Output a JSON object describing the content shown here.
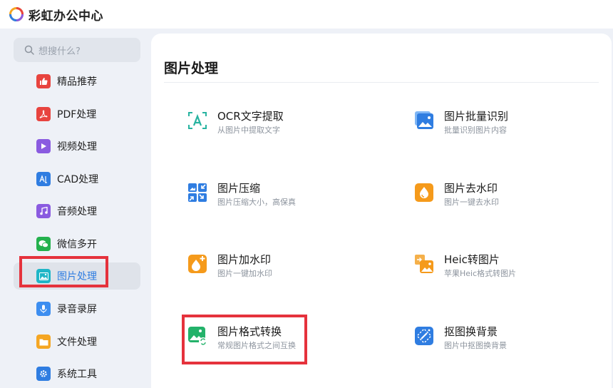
{
  "app": {
    "title": "彩虹办公中心"
  },
  "search": {
    "placeholder": "想搜什么?"
  },
  "sidebar": {
    "items": [
      {
        "label": "精品推荐",
        "icon": "thumbs-up-icon",
        "color": "#e8443f"
      },
      {
        "label": "PDF处理",
        "icon": "pdf-icon",
        "color": "#e8443f"
      },
      {
        "label": "视频处理",
        "icon": "video-play-icon",
        "color": "#8a5be0"
      },
      {
        "label": "CAD处理",
        "icon": "cad-icon",
        "color": "#2f7de1"
      },
      {
        "label": "音频处理",
        "icon": "music-note-icon",
        "color": "#8a5be0"
      },
      {
        "label": "微信多开",
        "icon": "wechat-icon",
        "color": "#23b14d"
      },
      {
        "label": "图片处理",
        "icon": "image-icon",
        "color": "#1fb6c7",
        "active": true
      },
      {
        "label": "录音录屏",
        "icon": "microphone-icon",
        "color": "#3d8ef0"
      },
      {
        "label": "文件处理",
        "icon": "folder-icon",
        "color": "#f5a623"
      },
      {
        "label": "系统工具",
        "icon": "gear-icon",
        "color": "#2f7de1"
      }
    ]
  },
  "main": {
    "section_title": "图片处理",
    "cards": [
      {
        "title": "OCR文字提取",
        "subtitle": "从图片中提取文字",
        "icon": "ocr-scan-icon"
      },
      {
        "title": "图片批量识别",
        "subtitle": "批量识别图片内容",
        "icon": "image-batch-icon"
      },
      {
        "title": "图片压缩",
        "subtitle": "图片压缩大小，高保真",
        "icon": "compress-icon"
      },
      {
        "title": "图片去水印",
        "subtitle": "图片一键去水印",
        "icon": "remove-watermark-icon"
      },
      {
        "title": "图片加水印",
        "subtitle": "图片一键加水印",
        "icon": "add-watermark-icon"
      },
      {
        "title": "Heic转图片",
        "subtitle": "苹果Heic格式转图片",
        "icon": "heic-convert-icon"
      },
      {
        "title": "图片格式转换",
        "subtitle": "常规图片格式之间互换",
        "icon": "format-convert-icon"
      },
      {
        "title": "抠图换背景",
        "subtitle": "图片中抠图换背景",
        "icon": "cutout-icon"
      }
    ]
  },
  "colors": {
    "highlight": "#e5323c",
    "accent_blue": "#2f7de1"
  }
}
